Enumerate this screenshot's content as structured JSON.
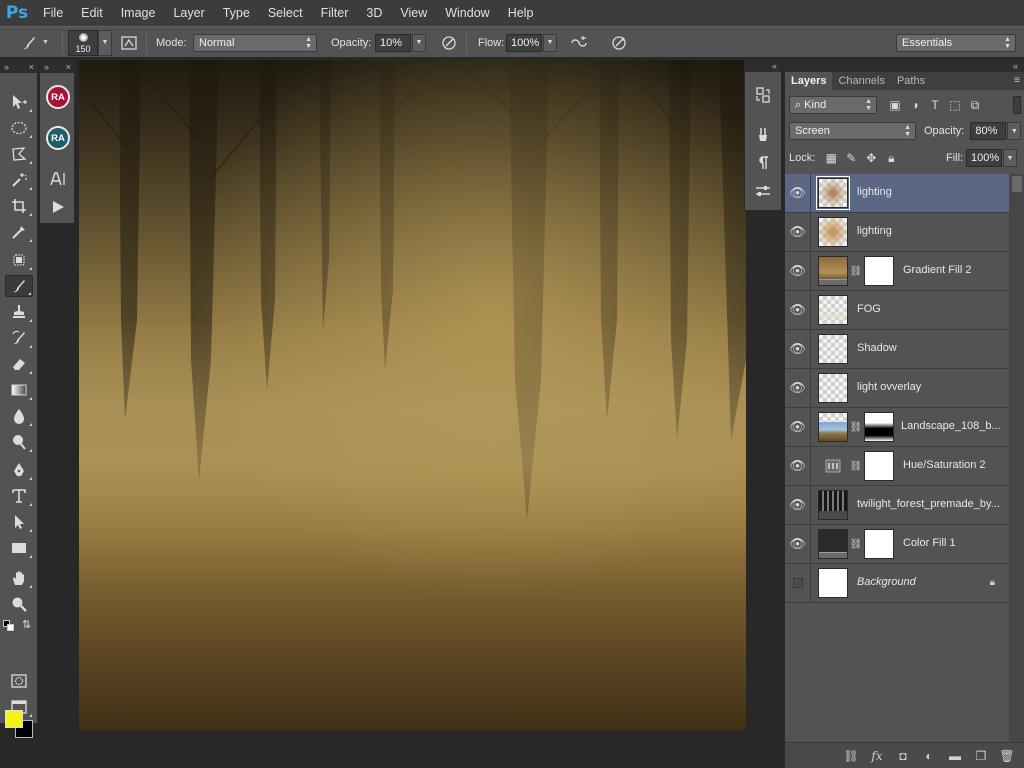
{
  "app": {
    "logo": "Ps"
  },
  "menu": [
    "File",
    "Edit",
    "Image",
    "Layer",
    "Type",
    "Select",
    "Filter",
    "3D",
    "View",
    "Window",
    "Help"
  ],
  "options": {
    "brush_size": "150",
    "mode_label": "Mode:",
    "mode_value": "Normal",
    "opacity_label": "Opacity:",
    "opacity_value": "10%",
    "flow_label": "Flow:",
    "flow_value": "100%",
    "workspace": "Essentials"
  },
  "style_panel": {
    "badge_1": "RA",
    "badge_2": "RA",
    "badge_1_color": "#a8123a",
    "badge_2_color": "#1f5e67"
  },
  "colors": {
    "foreground": "#f6f416",
    "background": "#000000",
    "selection": "#5b6784"
  },
  "layers_panel": {
    "tabs": [
      "Layers",
      "Channels",
      "Paths"
    ],
    "active_tab": "Layers",
    "kind_filter": "Kind",
    "blend_mode": "Screen",
    "opacity_label": "Opacity:",
    "opacity_value": "80%",
    "lock_label": "Lock:",
    "fill_label": "Fill:",
    "fill_value": "100%",
    "layers": [
      {
        "name": "lighting",
        "visible": true,
        "selected": true,
        "thumb": "lighting",
        "mask": false,
        "locked": false
      },
      {
        "name": "lighting",
        "visible": true,
        "selected": false,
        "thumb": "lighting",
        "mask": false,
        "locked": false
      },
      {
        "name": "Gradient Fill 2",
        "visible": true,
        "selected": false,
        "thumb": "gradient",
        "mask": true,
        "locked": false
      },
      {
        "name": "FOG",
        "visible": true,
        "selected": false,
        "thumb": "checker",
        "mask": false,
        "locked": false
      },
      {
        "name": "Shadow",
        "visible": true,
        "selected": false,
        "thumb": "checker",
        "mask": false,
        "locked": false
      },
      {
        "name": "light ovverlay",
        "visible": true,
        "selected": false,
        "thumb": "checker",
        "mask": false,
        "locked": false
      },
      {
        "name": "Landscape_108_b...",
        "visible": true,
        "selected": false,
        "thumb": "landscape",
        "mask": true,
        "locked": false
      },
      {
        "name": "Hue/Saturation 2",
        "visible": true,
        "selected": false,
        "thumb": "adjustment",
        "mask": true,
        "locked": false
      },
      {
        "name": "twilight_forest_premade_by...",
        "visible": true,
        "selected": false,
        "thumb": "forest",
        "mask": false,
        "locked": false
      },
      {
        "name": "Color Fill 1",
        "visible": true,
        "selected": false,
        "thumb": "colorfill",
        "mask": true,
        "locked": false
      },
      {
        "name": "Background",
        "visible": false,
        "selected": false,
        "thumb": "white",
        "mask": false,
        "locked": true
      }
    ]
  }
}
